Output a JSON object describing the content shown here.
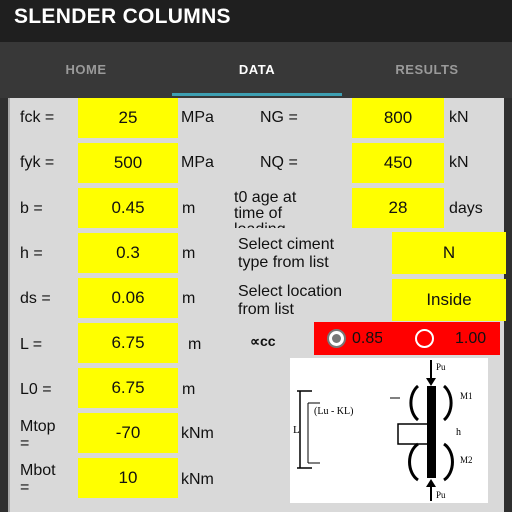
{
  "app": {
    "title": "SLENDER COLUMNS"
  },
  "tabs": [
    {
      "label": "HOME"
    },
    {
      "label": "DATA"
    },
    {
      "label": "RESULTS"
    }
  ],
  "fields_left": [
    {
      "label": "fck =",
      "value": "25",
      "unit": "MPa"
    },
    {
      "label": "fyk =",
      "value": "500",
      "unit": "MPa"
    },
    {
      "label": "b =",
      "value": "0.45",
      "unit": "m"
    },
    {
      "label": "h =",
      "value": "0.3",
      "unit": "m"
    },
    {
      "label": "ds =",
      "value": "0.06",
      "unit": "m"
    },
    {
      "label": "L =",
      "value": "6.75",
      "unit": "m"
    },
    {
      "label": "L0 =",
      "value": "6.75",
      "unit": "m"
    },
    {
      "label_line1": "Mtop",
      "label_line2": "=",
      "value": "-70",
      "unit": "kNm"
    },
    {
      "label_line1": "Mbot",
      "label_line2": "=",
      "value": "10",
      "unit": "kNm"
    }
  ],
  "fields_right": [
    {
      "label": "NG =",
      "value": "800",
      "unit": "kN"
    },
    {
      "label": "NQ =",
      "value": "450",
      "unit": "kN"
    },
    {
      "label_line1": "t0 age at",
      "label_line2": "time of",
      "label_line3": "loading",
      "value": "28",
      "unit": "days"
    },
    {
      "label_line1": "Select ciment",
      "label_line2": "type from list",
      "value": "N"
    },
    {
      "label_line1": "Select location",
      "label_line2": "from list",
      "value": "Inside"
    }
  ],
  "alpha_cc": {
    "label": "∝cc",
    "options": [
      {
        "label": "0.85",
        "checked": true
      },
      {
        "label": "1.00",
        "checked": false
      }
    ],
    "background": "#ff0000"
  },
  "diagram": {
    "top_load": "Pu",
    "bottom_load": "Pu",
    "top_moment": "M1",
    "bottom_moment": "M2",
    "offset": "(Lu - KL)",
    "length": "L",
    "section": "h"
  },
  "colors": {
    "field": "#ffff00",
    "panel": "#d9d9d9",
    "tab_indicator": "#3d9fb2"
  }
}
